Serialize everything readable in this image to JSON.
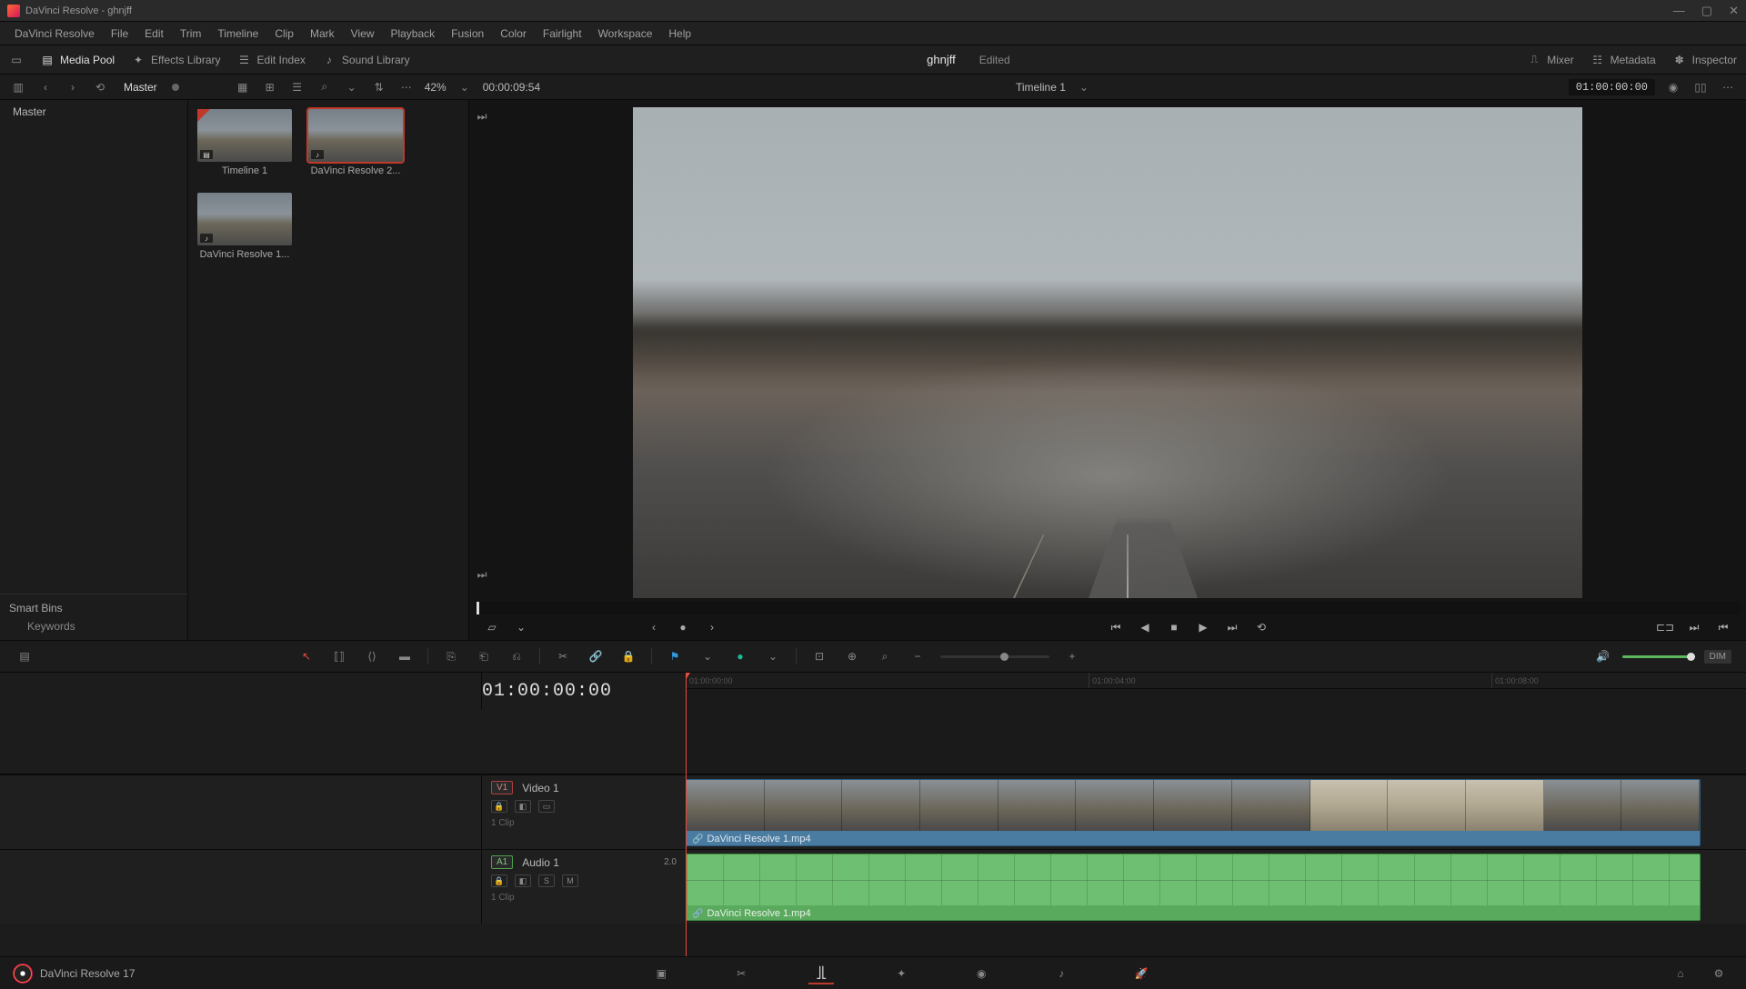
{
  "title": "DaVinci Resolve - ghnjff",
  "menu": [
    "DaVinci Resolve",
    "File",
    "Edit",
    "Trim",
    "Timeline",
    "Clip",
    "Mark",
    "View",
    "Playback",
    "Fusion",
    "Color",
    "Fairlight",
    "Workspace",
    "Help"
  ],
  "toolbar": {
    "media_pool": "Media Pool",
    "effects_library": "Effects Library",
    "edit_index": "Edit Index",
    "sound_library": "Sound Library",
    "project": "ghnjff",
    "edited": "Edited",
    "mixer": "Mixer",
    "metadata": "Metadata",
    "inspector": "Inspector"
  },
  "optionsbar": {
    "breadcrumb": "Master",
    "zoom_pct": "42%",
    "src_tc": "00:00:09:54",
    "timeline_name": "Timeline 1",
    "rec_tc": "01:00:00:00"
  },
  "sidebar": {
    "master": "Master",
    "smart_bins": "Smart Bins",
    "keywords": "Keywords"
  },
  "clips": [
    {
      "label": "Timeline 1",
      "type": "timeline",
      "selected": false
    },
    {
      "label": "DaVinci Resolve 2...",
      "type": "video",
      "selected": true
    },
    {
      "label": "DaVinci Resolve 1...",
      "type": "video",
      "selected": false
    }
  ],
  "timeline": {
    "big_tc": "01:00:00:00",
    "ruler": [
      "01:00:00:00",
      "01:00:04:00",
      "01:00:08:00"
    ],
    "video_track": {
      "tag": "V1",
      "name": "Video 1",
      "info": "1 Clip"
    },
    "audio_track": {
      "tag": "A1",
      "name": "Audio 1",
      "level": "2.0",
      "info": "1 Clip",
      "solo": "S",
      "mute": "M"
    },
    "clip_name": "DaVinci Resolve 1.mp4",
    "dim": "DIM"
  },
  "footer": {
    "app": "DaVinci Resolve 17"
  }
}
